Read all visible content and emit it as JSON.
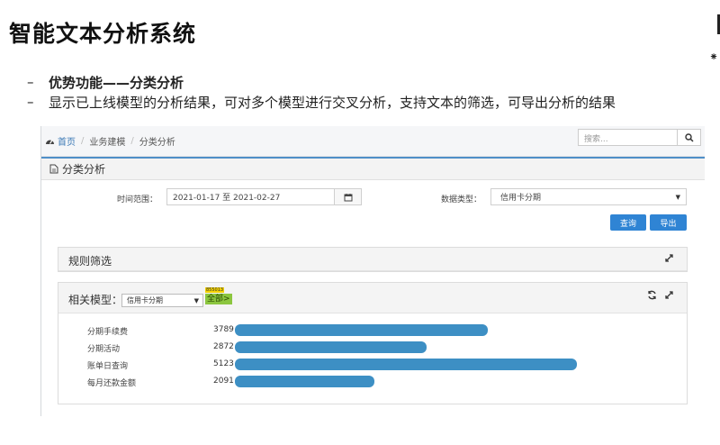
{
  "slide": {
    "title": "智能文本分析系统",
    "bullets": [
      {
        "dash": "–",
        "text": "优势功能——分类分析",
        "bold": true
      },
      {
        "dash": "–",
        "text": "显示已上线模型的分析结果，可对多个模型进行交叉分析，支持文本的筛选，可导出分析的结果",
        "bold": false
      }
    ]
  },
  "topbar": {
    "breadcrumb": [
      "首页",
      "业务建模",
      "分类分析"
    ],
    "breadcrumb_sep": "/",
    "search_placeholder": "搜索..."
  },
  "panel": {
    "title": "分类分析",
    "time_label": "时间范围：",
    "date_range": "2021-01-17 至 2021-02-27",
    "data_type_label": "数据类型：",
    "data_type_value": "信用卡分期",
    "query_button": "查询",
    "export_button": "导出"
  },
  "rule_filter": {
    "title": "规则筛选"
  },
  "related": {
    "title": "相关模型：",
    "model_value": "信用卡分期",
    "all_tag": "全部>",
    "tiny_tag": "855013"
  },
  "chart_data": {
    "type": "bar",
    "orientation": "horizontal",
    "categories": [
      "分期手续费",
      "分期活动",
      "账单日查询",
      "每月还款金额"
    ],
    "values": [
      3789,
      2872,
      5123,
      2091
    ],
    "max": 5123,
    "color": "#3d8fc4"
  },
  "icons": {
    "home": "dashboard-icon",
    "search": "search-icon",
    "calendar": "calendar-icon",
    "doc": "document-icon",
    "refresh": "refresh-icon",
    "expand": "expand-icon"
  }
}
